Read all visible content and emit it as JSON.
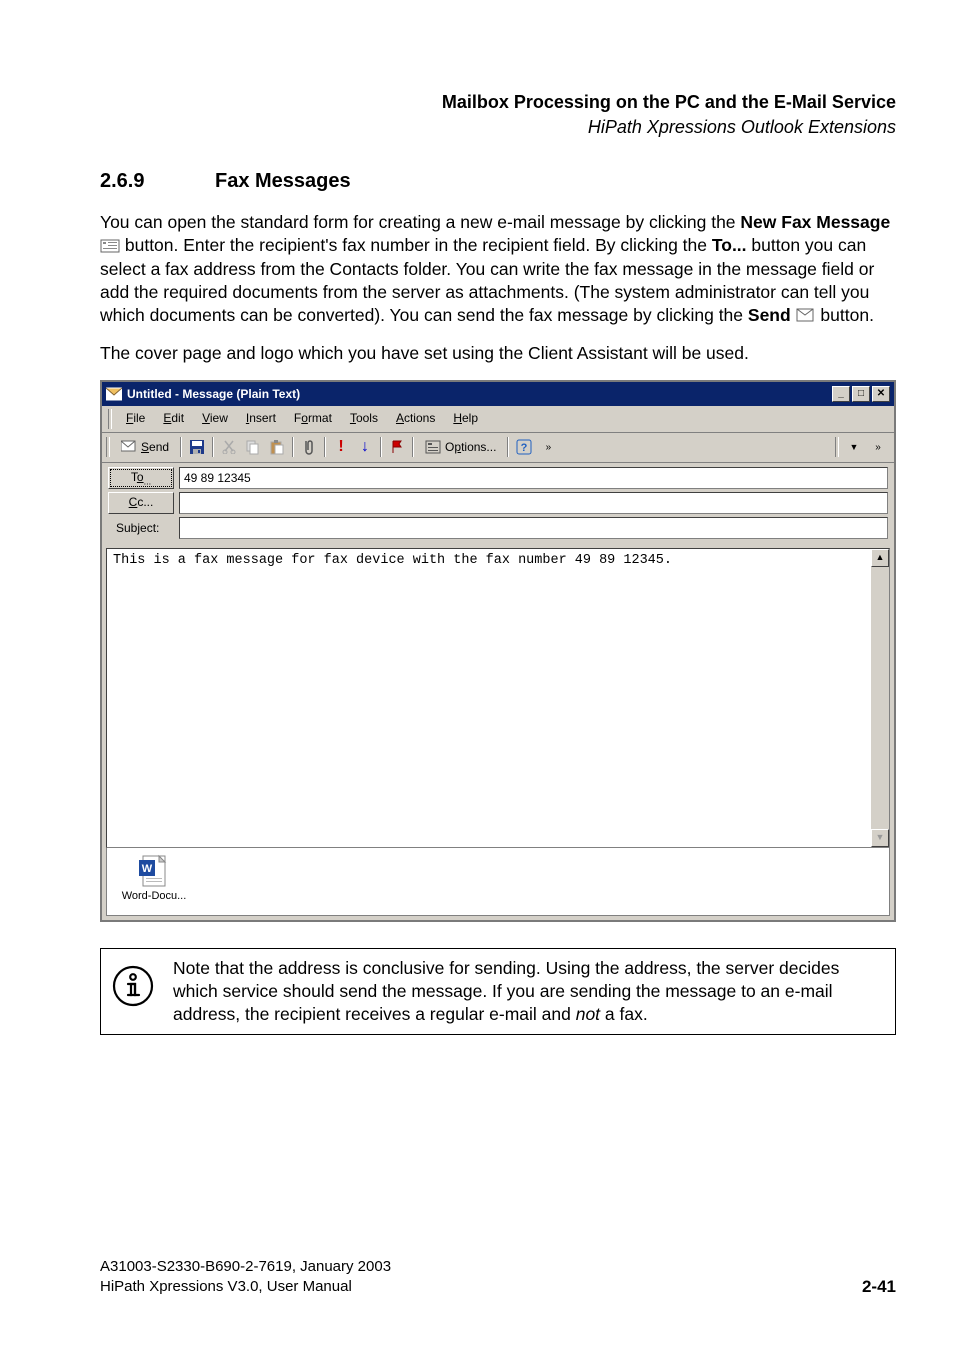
{
  "header": {
    "title": "Mailbox Processing on the PC and the E-Mail Service",
    "subtitle": "HiPath Xpressions Outlook Extensions"
  },
  "section": {
    "number": "2.6.9",
    "title": "Fax Messages"
  },
  "paragraphs": {
    "p1_part1": "You can open the standard form for creating a new e-mail message by clicking the ",
    "p1_bold1": "New Fax Message",
    "p1_part2": "  button. Enter the recipient's fax number in the recipient field. By clicking the ",
    "p1_bold2": "To...",
    "p1_part3": " button you can select a fax address from the Contacts folder. You can write the fax message in the message field or add the required documents from the server as attachments. (The system administrator can tell you which documents can be converted). You can send the fax message by clicking the ",
    "p1_bold3": "Send",
    "p1_part4": "  button.",
    "p2": "The cover page and logo which you have set using the Client Assistant will be used."
  },
  "outlook": {
    "title": "Untitled - Message (Plain Text)",
    "menu": {
      "file": "File",
      "edit": "Edit",
      "view": "View",
      "insert": "Insert",
      "format": "Format",
      "tools": "Tools",
      "actions": "Actions",
      "help": "Help"
    },
    "toolbar": {
      "send": "Send",
      "options": "Options..."
    },
    "address": {
      "to_label": "To...",
      "to_value": "49 89 12345",
      "cc_label": "Cc...",
      "cc_value": "",
      "subject_label": "Subject:",
      "subject_value": ""
    },
    "body_text": "This is a fax message for fax device with the fax number 49 89 12345.",
    "attachment": {
      "label": "Word-Docu..."
    },
    "window_controls": {
      "minimize": "_",
      "maximize": "□",
      "close": "✕"
    }
  },
  "note": {
    "text_part1": "Note that the address is conclusive for sending. Using the address, the server decides which service should send the message. If you are sending the message to an e-mail address, the recipient receives a regular e-mail and ",
    "italic": "not",
    "text_part2": " a fax."
  },
  "footer": {
    "line1": "A31003-S2330-B690-2-7619, January 2003",
    "line2": "HiPath Xpressions V3.0, User Manual",
    "page": "2-41"
  }
}
